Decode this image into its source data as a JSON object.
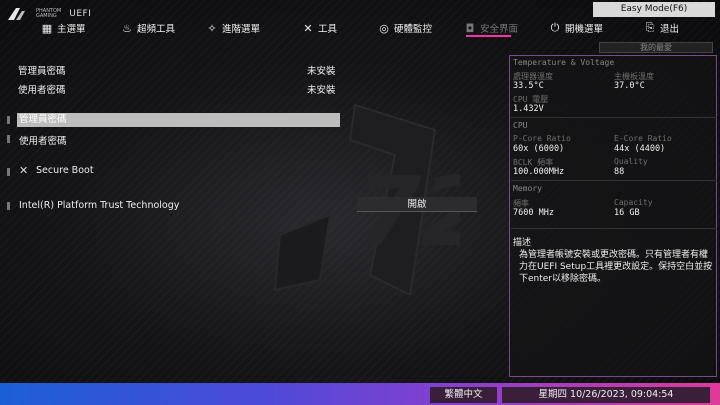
{
  "brand": {
    "logo_text_line1": "PHANTOM",
    "logo_text_line2": "GAMING",
    "uefi_label": "UEFI"
  },
  "easy_mode_label": "Easy Mode(F6)",
  "nav": {
    "items": [
      {
        "icon": "grid-icon",
        "label": "主選單"
      },
      {
        "icon": "flame-icon",
        "label": "超頻工具"
      },
      {
        "icon": "star-icon",
        "label": "進階選單"
      },
      {
        "icon": "tools-icon",
        "label": "工具"
      },
      {
        "icon": "monitor-icon",
        "label": "硬體監控"
      },
      {
        "icon": "shield-icon",
        "label": "安全界面"
      },
      {
        "icon": "power-icon",
        "label": "開機選單"
      },
      {
        "icon": "exit-icon",
        "label": "退出"
      }
    ],
    "active_index": 5,
    "active_color": "#ff2fa0"
  },
  "favorites_label": "我的最愛",
  "main": {
    "admin_password_label": "管理員密碼",
    "admin_password_value": "未安裝",
    "user_password_label": "使用者密碼",
    "user_password_value": "未安裝",
    "menu": [
      {
        "label": "管理員密碼",
        "selected": true
      },
      {
        "label": "使用者密碼",
        "selected": false
      },
      {
        "label": "Secure Boot",
        "icon": "wrench-icon"
      },
      {
        "label": "Intel(R) Platform Trust Technology",
        "value": "開啟"
      }
    ]
  },
  "panel": {
    "temp_header": "Temperature & Voltage",
    "cpu_temp_label": "處理器溫度",
    "cpu_temp_value": "33.5°C",
    "mb_temp_label": "主機板溫度",
    "mb_temp_value": "37.0°C",
    "cpu_volt_label": "CPU 電壓",
    "cpu_volt_value": "1.432V",
    "cpu_header": "CPU",
    "pcore_label": "P-Core Ratio",
    "pcore_value": "60x (6000)",
    "ecore_label": "E-Core Ratio",
    "ecore_value": "44x (4400)",
    "bclk_label": "BCLK 頻率",
    "bclk_value": "100.000MHz",
    "quality_label": "Quality",
    "quality_value": "88",
    "memory_header": "Memory",
    "freq_label": "頻率",
    "freq_value": "7600 MHz",
    "capacity_label": "Capacity",
    "capacity_value": "16 GB",
    "desc_title": "描述",
    "desc_text": "為管理者帳號安裝或更改密碼。只有管理者有權力在UEFI Setup工具裡更改設定。保持空白並按下enter以移除密碼。",
    "border_color": "#7a4a8a"
  },
  "footer": {
    "language": "繁體中文",
    "datetime": "星期四 10/26/2023, 09:04:54"
  }
}
